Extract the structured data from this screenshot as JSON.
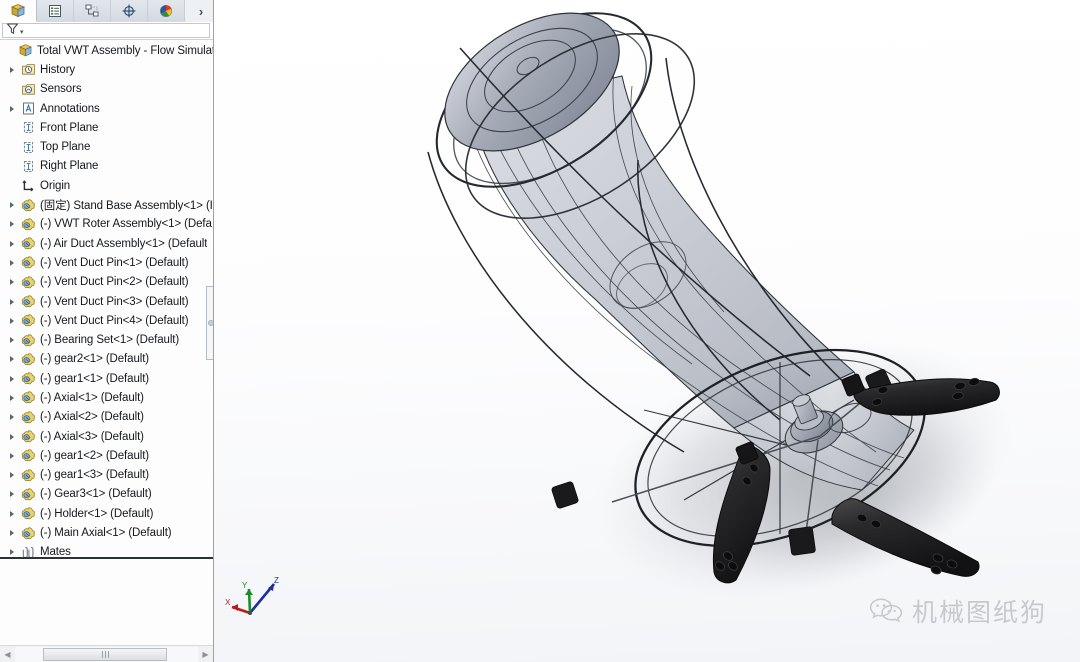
{
  "app": {
    "title": "SolidWorks Assembly",
    "accent_color": "#1a6fbb",
    "panel_bg": "#fdfdfd",
    "viewport_bg_top": "#ffffff",
    "viewport_bg_bottom": "#f2f4f7"
  },
  "tabstrip": {
    "tabs": [
      {
        "name": "feature-manager-design-tree",
        "icon": "feature-tree-icon",
        "active": true
      },
      {
        "name": "property-manager",
        "icon": "property-list-icon",
        "active": false
      },
      {
        "name": "configuration-manager",
        "icon": "configuration-icon",
        "active": false
      },
      {
        "name": "dimxpert-manager",
        "icon": "dimxpert-icon",
        "active": false
      },
      {
        "name": "display-manager",
        "icon": "display-appearance-icon",
        "active": false
      }
    ],
    "overflow_label": "›"
  },
  "filter": {
    "icon": "filter-funnel-icon",
    "value": "",
    "placeholder": "",
    "dropdown_caret": "▾"
  },
  "tree": {
    "items": [
      {
        "label": "Total VWT Assembly - Flow Simulation",
        "icon": "assembly-icon",
        "expander": false,
        "indent": 0
      },
      {
        "label": "History",
        "icon": "history-icon",
        "expander": true,
        "indent": 1
      },
      {
        "label": "Sensors",
        "icon": "sensors-icon",
        "expander": false,
        "indent": 1
      },
      {
        "label": "Annotations",
        "icon": "annotations-icon",
        "expander": true,
        "indent": 1
      },
      {
        "label": "Front Plane",
        "icon": "plane-icon",
        "expander": false,
        "indent": 1
      },
      {
        "label": "Top Plane",
        "icon": "plane-icon",
        "expander": false,
        "indent": 1
      },
      {
        "label": "Right Plane",
        "icon": "plane-icon",
        "expander": false,
        "indent": 1
      },
      {
        "label": "Origin",
        "icon": "origin-icon",
        "expander": false,
        "indent": 1
      },
      {
        "label": "(固定) Stand Base Assembly<1> (I",
        "icon": "component-icon",
        "expander": true,
        "indent": 1
      },
      {
        "label": "(-) VWT Roter Assembly<1> (Defa",
        "icon": "component-icon",
        "expander": true,
        "indent": 1
      },
      {
        "label": "(-) Air Duct Assembly<1> (Default",
        "icon": "component-icon",
        "expander": true,
        "indent": 1
      },
      {
        "label": "(-) Vent Duct Pin<1> (Default)",
        "icon": "component-icon",
        "expander": true,
        "indent": 1
      },
      {
        "label": "(-) Vent Duct Pin<2> (Default)",
        "icon": "component-icon",
        "expander": true,
        "indent": 1
      },
      {
        "label": "(-) Vent Duct Pin<3> (Default)",
        "icon": "component-icon",
        "expander": true,
        "indent": 1
      },
      {
        "label": "(-) Vent Duct Pin<4> (Default)",
        "icon": "component-icon",
        "expander": true,
        "indent": 1
      },
      {
        "label": "(-) Bearing Set<1> (Default)",
        "icon": "component-icon",
        "expander": true,
        "indent": 1
      },
      {
        "label": "(-) gear2<1> (Default)",
        "icon": "component-icon",
        "expander": true,
        "indent": 1
      },
      {
        "label": "(-) gear1<1> (Default)",
        "icon": "component-icon",
        "expander": true,
        "indent": 1
      },
      {
        "label": "(-) Axial<1> (Default)",
        "icon": "component-icon",
        "expander": true,
        "indent": 1
      },
      {
        "label": "(-) Axial<2> (Default)",
        "icon": "component-icon",
        "expander": true,
        "indent": 1
      },
      {
        "label": "(-) Axial<3> (Default)",
        "icon": "component-icon",
        "expander": true,
        "indent": 1
      },
      {
        "label": "(-) gear1<2> (Default)",
        "icon": "component-icon",
        "expander": true,
        "indent": 1
      },
      {
        "label": "(-) gear1<3> (Default)",
        "icon": "component-icon",
        "expander": true,
        "indent": 1
      },
      {
        "label": "(-) Gear3<1> (Default)",
        "icon": "component-icon",
        "expander": true,
        "indent": 1
      },
      {
        "label": "(-) Holder<1> (Default)",
        "icon": "component-icon",
        "expander": true,
        "indent": 1
      },
      {
        "label": "(-) Main Axial<1> (Default)",
        "icon": "component-icon",
        "expander": true,
        "indent": 1
      },
      {
        "label": "Mates",
        "icon": "mates-icon",
        "expander": true,
        "indent": 1
      }
    ]
  },
  "scrollbar": {
    "left_arrow": "◀",
    "right_arrow": "▶",
    "grip": "|||"
  },
  "viewport": {
    "model_name": "Total VWT Assembly",
    "triad": {
      "x_label": "X",
      "x_color": "#c01818",
      "y_label": "Y",
      "y_color": "#1f8a2a",
      "z_label": "Z",
      "z_color": "#1b2f9e"
    },
    "watermark": {
      "text": "机械图纸狗",
      "icon": "wechat-icon"
    }
  }
}
